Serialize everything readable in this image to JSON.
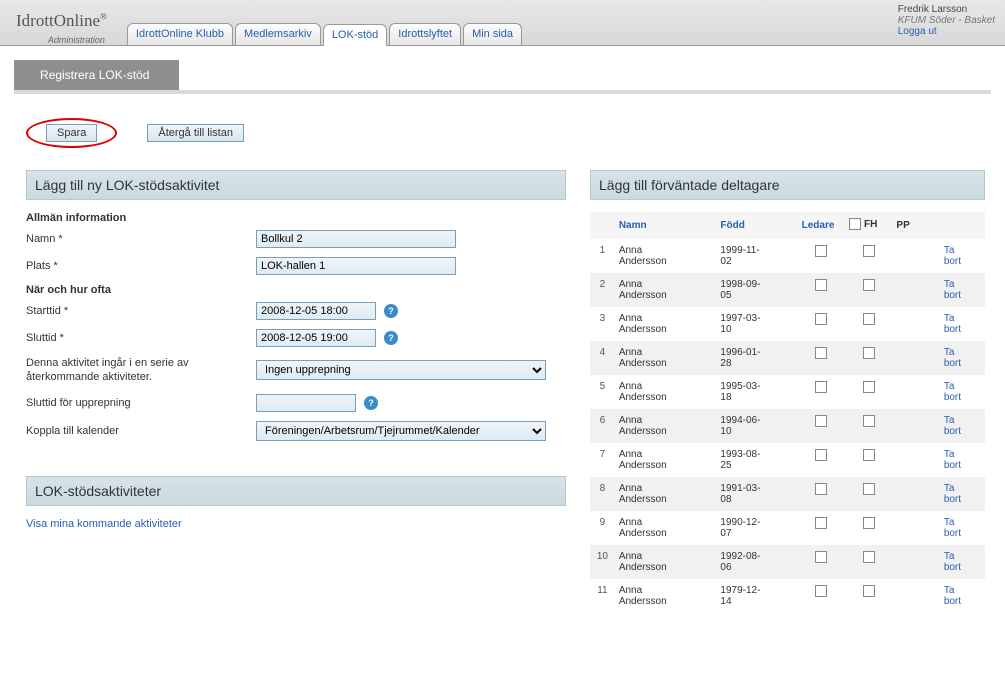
{
  "header": {
    "logo": "IdrottOnline",
    "logo_sub": "Administration",
    "tabs": [
      "IdrottOnline Klubb",
      "Medlemsarkiv",
      "LOK-stöd",
      "Idrottslyftet",
      "Min sida"
    ],
    "active_tab": 2,
    "user_name": "Fredrik Larsson",
    "user_org": "KFUM Söder - Basket",
    "logout": "Logga ut"
  },
  "subheader": {
    "title": "Registrera LOK-stöd"
  },
  "buttons": {
    "save": "Spara",
    "return": "Återgå till listan"
  },
  "left_panel": {
    "title": "Lägg till ny LOK-stödsaktivitet",
    "section_general": "Allmän information",
    "label_name": "Namn *",
    "value_name": "Bollkul 2",
    "label_place": "Plats *",
    "value_place": "LOK-hallen 1",
    "section_when": "När och hur ofta",
    "label_start": "Starttid *",
    "value_start": "2008-12-05 18:00",
    "label_end": "Sluttid *",
    "value_end": "2008-12-05 19:00",
    "label_series": "Denna aktivitet ingår i en serie av återkommande aktiviteter.",
    "value_series": "Ingen upprepning",
    "label_repeat_end": "Sluttid för upprepning",
    "value_repeat_end": "",
    "label_calendar": "Koppla till kalender",
    "value_calendar": "Föreningen/Arbetsrum/Tjejrummet/Kalender",
    "activities_title": "LOK-stödsaktiviteter",
    "activities_link": "Visa mina kommande aktiviteter"
  },
  "right_panel": {
    "title": "Lägg till förväntade deltagare",
    "th_name": "Namn",
    "th_born": "Född",
    "th_leader": "Ledare",
    "th_fh": "FH",
    "th_pp": "PP",
    "remove_label": "Ta bort",
    "rows": [
      {
        "idx": "1",
        "name": "Anna Andersson",
        "born": "1999-11-02"
      },
      {
        "idx": "2",
        "name": "Anna Andersson",
        "born": "1998-09-05"
      },
      {
        "idx": "3",
        "name": "Anna Andersson",
        "born": "1997-03-10"
      },
      {
        "idx": "4",
        "name": "Anna Andersson",
        "born": "1996-01-28"
      },
      {
        "idx": "5",
        "name": "Anna Andersson",
        "born": "1995-03-18"
      },
      {
        "idx": "6",
        "name": "Anna Andersson",
        "born": "1994-06-10"
      },
      {
        "idx": "7",
        "name": "Anna Andersson",
        "born": "1993-08-25"
      },
      {
        "idx": "8",
        "name": "Anna Andersson",
        "born": "1991-03-08"
      },
      {
        "idx": "9",
        "name": "Anna Andersson",
        "born": "1990-12-07"
      },
      {
        "idx": "10",
        "name": "Anna Andersson",
        "born": "1992-08-06"
      },
      {
        "idx": "11",
        "name": "Anna Andersson",
        "born": "1979-12-14"
      }
    ]
  }
}
